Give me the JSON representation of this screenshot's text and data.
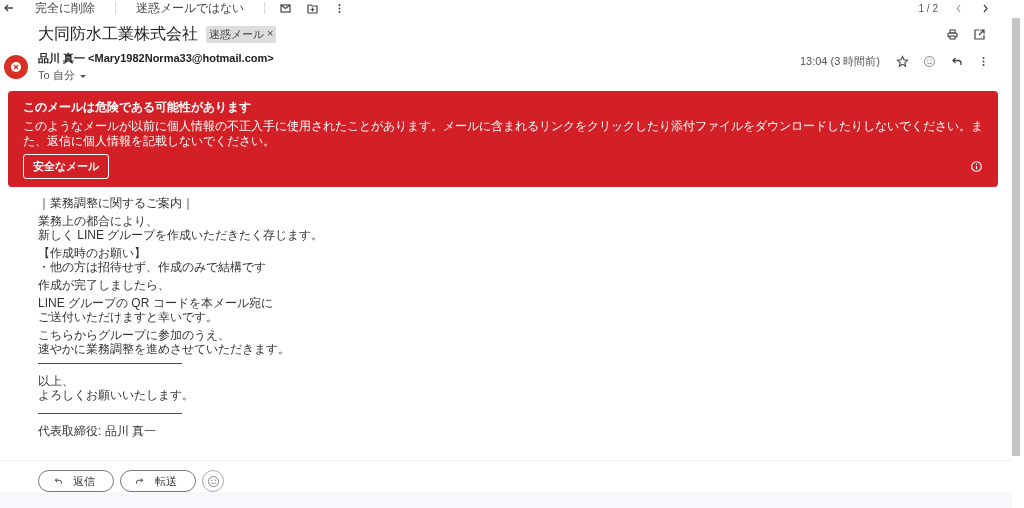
{
  "toolbar": {
    "actions": [
      {
        "kind": "back"
      },
      {
        "kind": "text",
        "label": "完全に削除"
      },
      {
        "kind": "divider"
      },
      {
        "kind": "text",
        "label": "迷惑メールではない"
      },
      {
        "kind": "divider"
      },
      {
        "kind": "mail"
      },
      {
        "kind": "move"
      },
      {
        "kind": "more"
      }
    ],
    "pager": "1 / 2"
  },
  "subject": {
    "title": "大同防水工業株式会社",
    "label": {
      "text": "迷惑メール",
      "close": "×"
    }
  },
  "sender": {
    "from": "品川 真一 <Mary1982Norma33@hotmail.com>",
    "to": "To 自分",
    "time": "13:04 (3 時間前)",
    "starred": false
  },
  "warning": {
    "title": "このメールは危険である可能性があります",
    "message": "このようなメールが以前に個人情報の不正入手に使用されたことがあります。メールに含まれるリンクをクリックしたり添付ファイルをダウンロードしたりしないでください。また、返信に個人情報を記載しないでください。",
    "button": "安全なメール"
  },
  "body": [
    [
      "｜業務調整に関するご案内｜"
    ],
    [
      "業務上の都合により、",
      "新しく LINE グループを作成いただきたく存じます。"
    ],
    [
      "【作成時のお願い】",
      "・他の方は招待せず、作成のみで結構です"
    ],
    [
      "作成が完了しましたら、"
    ],
    [
      "LINE グループの QR コードを本メール宛に",
      "ご送付いただけますと幸いです。"
    ],
    [
      "こちらからグループに参加のうえ、",
      "速やかに業務調整を進めさせていただきます。",
      "————————————"
    ],
    [
      "以上、",
      "よろしくお願いいたします。"
    ],
    [
      "————————————"
    ],
    [
      "代表取締役: 品川 真一"
    ]
  ],
  "actions": [
    {
      "kind": "reply",
      "label": "返信"
    },
    {
      "kind": "forward",
      "label": "転送"
    },
    {
      "kind": "emoji"
    }
  ]
}
